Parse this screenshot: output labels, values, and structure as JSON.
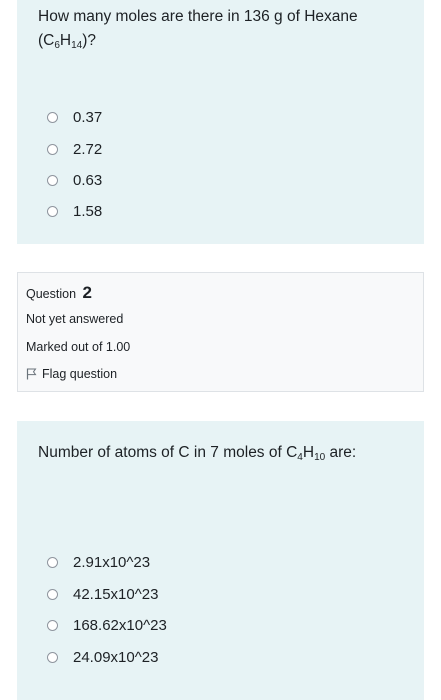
{
  "question1": {
    "text_prefix": "How many moles are there in 136 g of Hexane",
    "formula_open": "(C",
    "sub1": "6",
    "mid": "H",
    "sub2": "14",
    "formula_close": ")?",
    "options": [
      "0.37",
      "2.72",
      "0.63",
      "1.58"
    ]
  },
  "question2_info": {
    "question_label": "Question",
    "question_number": "2",
    "status": "Not yet answered",
    "marked_out_of": "Marked out of 1.00",
    "flag_label": "Flag question"
  },
  "question2": {
    "text_prefix": "Number of atoms of C in 7 moles of C",
    "sub1": "4",
    "mid": "H",
    "sub2": "10",
    "text_suffix": " are:",
    "options": [
      "2.91x10^23",
      "42.15x10^23",
      "168.62x10^23",
      "24.09x10^23"
    ]
  }
}
